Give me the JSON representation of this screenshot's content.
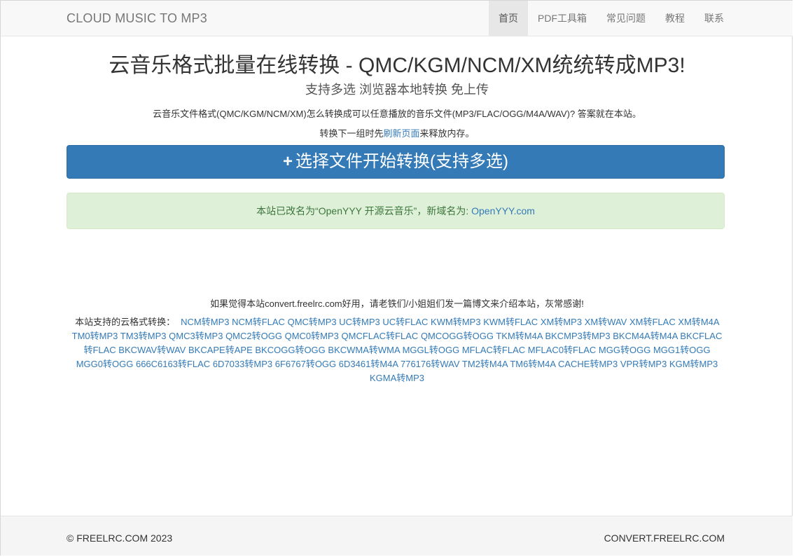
{
  "navbar": {
    "brand": "CLOUD MUSIC TO MP3",
    "items": [
      {
        "label": "首页"
      },
      {
        "label": "PDF工具箱"
      },
      {
        "label": "常见问题"
      },
      {
        "label": "教程"
      },
      {
        "label": "联系"
      }
    ]
  },
  "hero": {
    "title": "云音乐格式批量在线转换 - QMC/KGM/NCM/XM统统转成MP3!",
    "subtitle": "支持多选 浏览器本地转换 免上传",
    "description": "云音乐文件格式(QMC/KGM/NCM/XM)怎么转换成可以任意播放的音乐文件(MP3/FLAC/OGG/M4A/WAV)?  答案就在本站。",
    "refresh_before": "转换下一组时先",
    "refresh_link": "刷新页面",
    "refresh_after": "来释放内存。"
  },
  "convert_button": {
    "icon": "plus-icon",
    "label": "选择文件开始转换(支持多选)"
  },
  "notice": {
    "text": "本站已改名为“OpenYYY 开源云音乐”，新域名为: ",
    "link": "OpenYYY.com"
  },
  "thanks": "如果觉得本站convert.freelrc.com好用，请老铁们/小姐姐们发一篇博文来介绍本站，灰常感谢!",
  "formats": {
    "label": "本站支持的云格式转换：",
    "links": [
      "NCM转MP3",
      "NCM转FLAC",
      "QMC转MP3",
      "UC转MP3",
      "UC转FLAC",
      "KWM转MP3",
      "KWM转FLAC",
      "XM转MP3",
      "XM转WAV",
      "XM转FLAC",
      "XM转M4A",
      "TM0转MP3",
      "TM3转MP3",
      "QMC3转MP3",
      "QMC2转OGG",
      "QMC0转MP3",
      "QMCFLAC转FLAC",
      "QMCOGG转OGG",
      "TKM转M4A",
      "BKCMP3转MP3",
      "BKCM4A转M4A",
      "BKCFLAC转FLAC",
      "BKCWAV转WAV",
      "BKCAPE转APE",
      "BKCOGG转OGG",
      "BKCWMA转WMA",
      "MGGL转OGG",
      "MFLAC转FLAC",
      "MFLAC0转FLAC",
      "MGG转OGG",
      "MGG1转OGG",
      "MGG0转OGG",
      "666C6163转FLAC",
      "6D7033转MP3",
      "6F6767转OGG",
      "6D3461转M4A",
      "776176转WAV",
      "TM2转M4A",
      "TM6转M4A",
      "CACHE转MP3",
      "VPR转MP3",
      "KGM转MP3",
      "KGMA转MP3"
    ]
  },
  "footer": {
    "copyright": "© FREELRC.COM 2023",
    "domain": "CONVERT.FREELRC.COM"
  },
  "colors": {
    "primary": "#337ab7",
    "success_bg": "#dff0d8",
    "success_text": "#3c763d",
    "navbar_bg": "#f8f8f8"
  }
}
